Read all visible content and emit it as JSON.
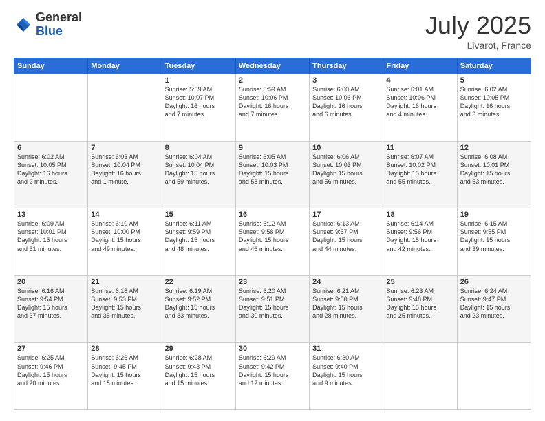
{
  "header": {
    "logo_general": "General",
    "logo_blue": "Blue",
    "month": "July 2025",
    "location": "Livarot, France"
  },
  "weekdays": [
    "Sunday",
    "Monday",
    "Tuesday",
    "Wednesday",
    "Thursday",
    "Friday",
    "Saturday"
  ],
  "weeks": [
    [
      {
        "day": "",
        "text": ""
      },
      {
        "day": "",
        "text": ""
      },
      {
        "day": "1",
        "text": "Sunrise: 5:59 AM\nSunset: 10:07 PM\nDaylight: 16 hours\nand 7 minutes."
      },
      {
        "day": "2",
        "text": "Sunrise: 5:59 AM\nSunset: 10:06 PM\nDaylight: 16 hours\nand 7 minutes."
      },
      {
        "day": "3",
        "text": "Sunrise: 6:00 AM\nSunset: 10:06 PM\nDaylight: 16 hours\nand 6 minutes."
      },
      {
        "day": "4",
        "text": "Sunrise: 6:01 AM\nSunset: 10:06 PM\nDaylight: 16 hours\nand 4 minutes."
      },
      {
        "day": "5",
        "text": "Sunrise: 6:02 AM\nSunset: 10:05 PM\nDaylight: 16 hours\nand 3 minutes."
      }
    ],
    [
      {
        "day": "6",
        "text": "Sunrise: 6:02 AM\nSunset: 10:05 PM\nDaylight: 16 hours\nand 2 minutes."
      },
      {
        "day": "7",
        "text": "Sunrise: 6:03 AM\nSunset: 10:04 PM\nDaylight: 16 hours\nand 1 minute."
      },
      {
        "day": "8",
        "text": "Sunrise: 6:04 AM\nSunset: 10:04 PM\nDaylight: 15 hours\nand 59 minutes."
      },
      {
        "day": "9",
        "text": "Sunrise: 6:05 AM\nSunset: 10:03 PM\nDaylight: 15 hours\nand 58 minutes."
      },
      {
        "day": "10",
        "text": "Sunrise: 6:06 AM\nSunset: 10:03 PM\nDaylight: 15 hours\nand 56 minutes."
      },
      {
        "day": "11",
        "text": "Sunrise: 6:07 AM\nSunset: 10:02 PM\nDaylight: 15 hours\nand 55 minutes."
      },
      {
        "day": "12",
        "text": "Sunrise: 6:08 AM\nSunset: 10:01 PM\nDaylight: 15 hours\nand 53 minutes."
      }
    ],
    [
      {
        "day": "13",
        "text": "Sunrise: 6:09 AM\nSunset: 10:01 PM\nDaylight: 15 hours\nand 51 minutes."
      },
      {
        "day": "14",
        "text": "Sunrise: 6:10 AM\nSunset: 10:00 PM\nDaylight: 15 hours\nand 49 minutes."
      },
      {
        "day": "15",
        "text": "Sunrise: 6:11 AM\nSunset: 9:59 PM\nDaylight: 15 hours\nand 48 minutes."
      },
      {
        "day": "16",
        "text": "Sunrise: 6:12 AM\nSunset: 9:58 PM\nDaylight: 15 hours\nand 46 minutes."
      },
      {
        "day": "17",
        "text": "Sunrise: 6:13 AM\nSunset: 9:57 PM\nDaylight: 15 hours\nand 44 minutes."
      },
      {
        "day": "18",
        "text": "Sunrise: 6:14 AM\nSunset: 9:56 PM\nDaylight: 15 hours\nand 42 minutes."
      },
      {
        "day": "19",
        "text": "Sunrise: 6:15 AM\nSunset: 9:55 PM\nDaylight: 15 hours\nand 39 minutes."
      }
    ],
    [
      {
        "day": "20",
        "text": "Sunrise: 6:16 AM\nSunset: 9:54 PM\nDaylight: 15 hours\nand 37 minutes."
      },
      {
        "day": "21",
        "text": "Sunrise: 6:18 AM\nSunset: 9:53 PM\nDaylight: 15 hours\nand 35 minutes."
      },
      {
        "day": "22",
        "text": "Sunrise: 6:19 AM\nSunset: 9:52 PM\nDaylight: 15 hours\nand 33 minutes."
      },
      {
        "day": "23",
        "text": "Sunrise: 6:20 AM\nSunset: 9:51 PM\nDaylight: 15 hours\nand 30 minutes."
      },
      {
        "day": "24",
        "text": "Sunrise: 6:21 AM\nSunset: 9:50 PM\nDaylight: 15 hours\nand 28 minutes."
      },
      {
        "day": "25",
        "text": "Sunrise: 6:23 AM\nSunset: 9:48 PM\nDaylight: 15 hours\nand 25 minutes."
      },
      {
        "day": "26",
        "text": "Sunrise: 6:24 AM\nSunset: 9:47 PM\nDaylight: 15 hours\nand 23 minutes."
      }
    ],
    [
      {
        "day": "27",
        "text": "Sunrise: 6:25 AM\nSunset: 9:46 PM\nDaylight: 15 hours\nand 20 minutes."
      },
      {
        "day": "28",
        "text": "Sunrise: 6:26 AM\nSunset: 9:45 PM\nDaylight: 15 hours\nand 18 minutes."
      },
      {
        "day": "29",
        "text": "Sunrise: 6:28 AM\nSunset: 9:43 PM\nDaylight: 15 hours\nand 15 minutes."
      },
      {
        "day": "30",
        "text": "Sunrise: 6:29 AM\nSunset: 9:42 PM\nDaylight: 15 hours\nand 12 minutes."
      },
      {
        "day": "31",
        "text": "Sunrise: 6:30 AM\nSunset: 9:40 PM\nDaylight: 15 hours\nand 9 minutes."
      },
      {
        "day": "",
        "text": ""
      },
      {
        "day": "",
        "text": ""
      }
    ]
  ]
}
